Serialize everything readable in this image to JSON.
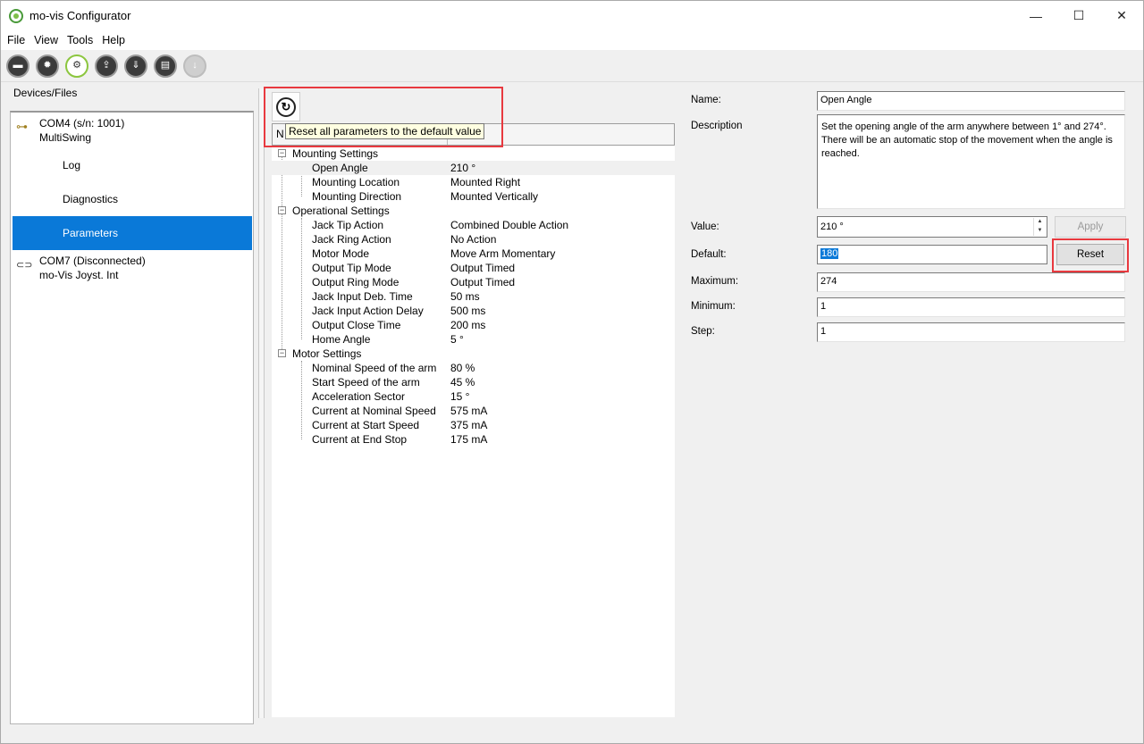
{
  "window": {
    "title": "mo-vis Configurator",
    "controls": {
      "minimize": "—",
      "maximize": "☐",
      "close": "✕"
    }
  },
  "menu": [
    "File",
    "View",
    "Tools",
    "Help"
  ],
  "toolbar": {
    "buttons": [
      {
        "icon": "open-folder-icon",
        "glyph": "▬"
      },
      {
        "icon": "flame-icon",
        "glyph": "✹"
      },
      {
        "icon": "gears-icon",
        "glyph": "⚙",
        "active": true
      },
      {
        "icon": "upload-icon",
        "glyph": "⇪"
      },
      {
        "icon": "download-icon",
        "glyph": "⇓"
      },
      {
        "icon": "document-icon",
        "glyph": "▤"
      },
      {
        "icon": "arrow-down-icon",
        "glyph": "↓",
        "disabled": true
      }
    ]
  },
  "devices_label": "Devices/Files",
  "devices": [
    {
      "line1": "COM4 (s/n: 1001)",
      "line2": "MultiSwing",
      "icon": "link-connected-icon",
      "glyph": "⊶"
    },
    {
      "line1": "COM7 (Disconnected)",
      "line2": "mo-Vis Joyst. Int",
      "icon": "link-broken-icon",
      "glyph": "⊂⊃"
    }
  ],
  "device_subitems": [
    "Log",
    "Diagnostics",
    "Parameters"
  ],
  "selected_subitem": "Parameters",
  "params": {
    "reset_all_tooltip": "Reset all parameters to the default value",
    "header_name": "N",
    "header_value": "",
    "groups": [
      {
        "label": "Mounting Settings",
        "toggle": "⊟",
        "items": [
          {
            "name": "Open Angle",
            "value": "210 °"
          },
          {
            "name": "Mounting Location",
            "value": "Mounted Right"
          },
          {
            "name": "Mounting Direction",
            "value": "Mounted Vertically"
          }
        ]
      },
      {
        "label": "Operational Settings",
        "toggle": "⊟",
        "items": [
          {
            "name": "Jack Tip Action",
            "value": "Combined Double Action"
          },
          {
            "name": "Jack Ring Action",
            "value": "No Action"
          },
          {
            "name": "Motor Mode",
            "value": "Move Arm Momentary"
          },
          {
            "name": "Output Tip Mode",
            "value": "Output Timed"
          },
          {
            "name": "Output Ring Mode",
            "value": "Output Timed"
          },
          {
            "name": "Jack Input Deb. Time",
            "value": "50 ms"
          },
          {
            "name": "Jack Input Action Delay",
            "value": "500 ms"
          },
          {
            "name": "Output Close Time",
            "value": "200 ms"
          },
          {
            "name": "Home Angle",
            "value": "5 °"
          }
        ]
      },
      {
        "label": "Motor Settings",
        "toggle": "⊟",
        "items": [
          {
            "name": "Nominal Speed of the arm",
            "value": "80 %"
          },
          {
            "name": "Start Speed of the arm",
            "value": "45 %"
          },
          {
            "name": "Acceleration Sector",
            "value": "15 °"
          },
          {
            "name": "Current at Nominal Speed",
            "value": "575 mA"
          },
          {
            "name": "Current at Start Speed",
            "value": "375 mA"
          },
          {
            "name": "Current at End Stop",
            "value": "175 mA"
          }
        ]
      }
    ]
  },
  "details": {
    "name_label": "Name:",
    "name_value": "Open Angle",
    "description_label": "Description",
    "description_value": "Set the opening angle of the arm anywhere between 1° and 274°. There will be an automatic stop of the movement when the angle is reached.",
    "value_label": "Value:",
    "value_value": "210 °",
    "apply_label": "Apply",
    "default_label": "Default:",
    "default_value": "180",
    "reset_label": "Reset",
    "maximum_label": "Maximum:",
    "maximum_value": "274",
    "minimum_label": "Minimum:",
    "minimum_value": "1",
    "step_label": "Step:",
    "step_value": "1"
  },
  "colors": {
    "selection": "#0a79d8",
    "highlight": "#e8393f"
  }
}
